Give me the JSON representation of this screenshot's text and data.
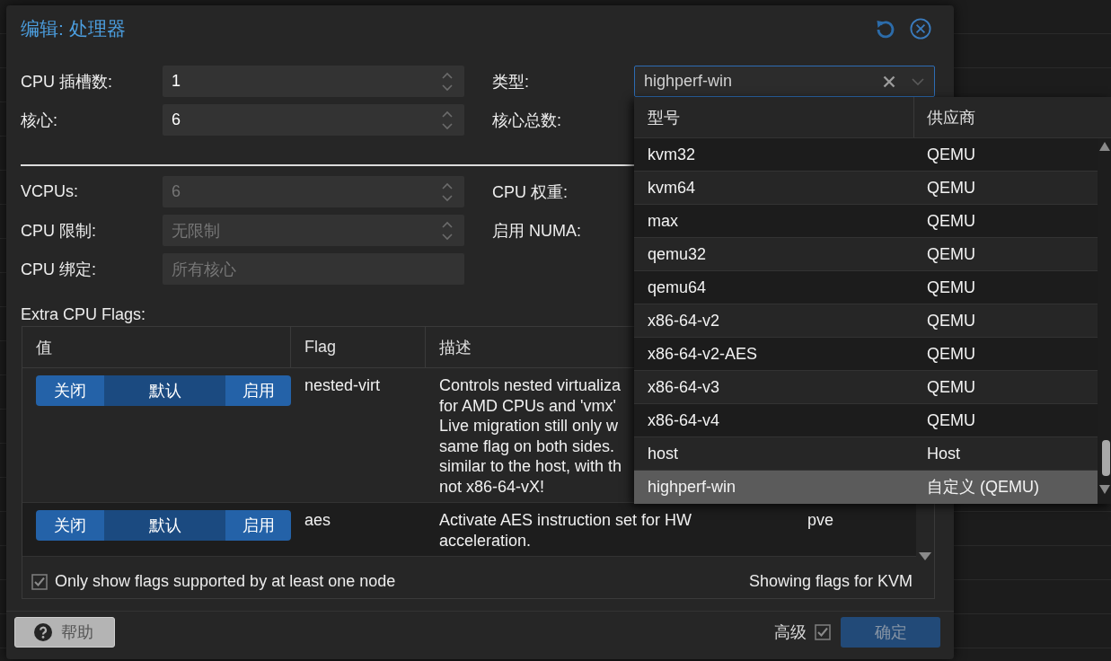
{
  "window": {
    "title": "编辑: 处理器"
  },
  "sections": [
    {
      "left": [
        {
          "label": "CPU 插槽数:",
          "value": "1",
          "spinner": true
        },
        {
          "label": "核心:",
          "value": "6",
          "spinner": true
        }
      ],
      "right": [
        {
          "label": "类型:",
          "combo": {
            "value": "highperf-win",
            "focused": true
          }
        },
        {
          "label": "核心总数:"
        }
      ]
    },
    {
      "left": [
        {
          "label": "VCPUs:",
          "placeholder": "6",
          "spinner": true
        },
        {
          "label": "CPU 限制:",
          "placeholder": "无限制",
          "spinner": true
        },
        {
          "label": "CPU 绑定:",
          "placeholder": "所有核心",
          "spinner": false
        }
      ],
      "right": [
        {
          "label": "CPU 权重:"
        },
        {
          "label": "启用 NUMA:"
        }
      ]
    }
  ],
  "flags": {
    "label": "Extra CPU Flags:",
    "columns": [
      "值",
      "Flag",
      "描述"
    ],
    "rows": [
      {
        "options": [
          {
            "label": "关闭",
            "selected": false
          },
          {
            "label": "默认",
            "selected": true
          },
          {
            "label": "启用",
            "selected": false
          }
        ],
        "flag": "nested-virt",
        "description_lines": [
          "Controls nested virtualiza",
          "for AMD CPUs and 'vmx'",
          "Live migration still only w",
          "same flag on both sides.",
          "similar to the host, with th",
          "not x86-64-vX!"
        ]
      },
      {
        "options": [
          {
            "label": "关闭",
            "selected": false
          },
          {
            "label": "默认",
            "selected": true
          },
          {
            "label": "启用",
            "selected": false
          }
        ],
        "flag": "aes",
        "description_lines": [
          "Activate AES instruction set for HW",
          "acceleration."
        ],
        "column_4": "pve"
      }
    ],
    "filter": {
      "label": "Only show flags supported by at least one node",
      "checked": true
    },
    "status": "Showing flags for KVM"
  },
  "type_picker": {
    "columns": [
      "型号",
      "供应商"
    ],
    "rows": [
      {
        "model": "kvm32",
        "vendor": "QEMU",
        "selected": false
      },
      {
        "model": "kvm64",
        "vendor": "QEMU",
        "selected": false
      },
      {
        "model": "max",
        "vendor": "QEMU",
        "selected": false
      },
      {
        "model": "qemu32",
        "vendor": "QEMU",
        "selected": false
      },
      {
        "model": "qemu64",
        "vendor": "QEMU",
        "selected": false
      },
      {
        "model": "x86-64-v2",
        "vendor": "QEMU",
        "selected": false
      },
      {
        "model": "x86-64-v2-AES",
        "vendor": "QEMU",
        "selected": false
      },
      {
        "model": "x86-64-v3",
        "vendor": "QEMU",
        "selected": false
      },
      {
        "model": "x86-64-v4",
        "vendor": "QEMU",
        "selected": false
      },
      {
        "model": "host",
        "vendor": "Host",
        "selected": false
      },
      {
        "model": "highperf-win",
        "vendor": "自定义 (QEMU)",
        "selected": true
      }
    ]
  },
  "footer": {
    "help_button": "帮助",
    "advanced": {
      "label": "高级",
      "checked": true
    },
    "ok_button": {
      "label": "确定",
      "disabled": true
    }
  }
}
